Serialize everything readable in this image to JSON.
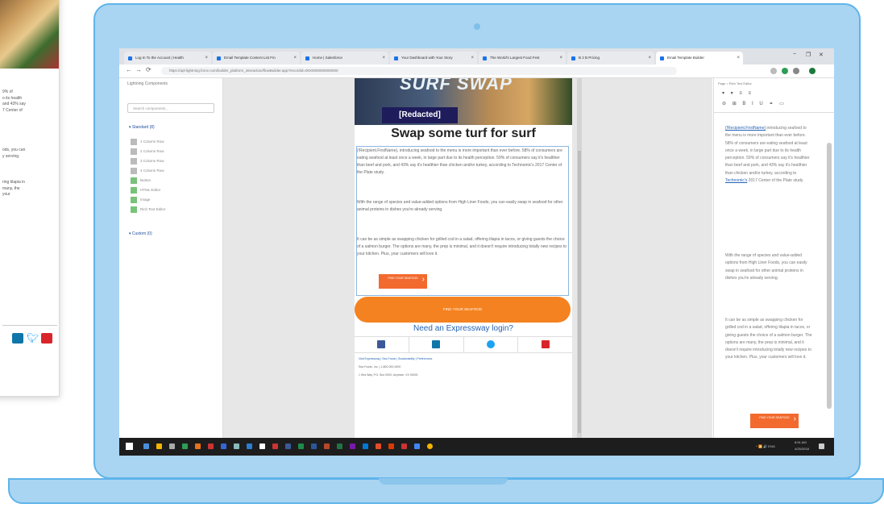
{
  "side_card": {
    "text_lines_1": [
      "9% of",
      "o its health",
      "and 43% say",
      "7 Center of"
    ],
    "text_lines_2": [
      "ods, you can",
      "y serving."
    ],
    "text_lines_3": [
      "ring tilapia in",
      "many, the",
      "your"
    ],
    "social_icons": [
      "linkedin-icon",
      "twitter-icon",
      "youtube-icon"
    ]
  },
  "browser": {
    "tabs": [
      {
        "label": "Log In To the Account | Health",
        "active": false
      },
      {
        "label": "Email Template Content List Fm",
        "active": false
      },
      {
        "label": "Home | Salesforce",
        "active": false
      },
      {
        "label": "Your Dashboard with Your Story",
        "active": false
      },
      {
        "label": "The World's Largest Food Fest",
        "active": false
      },
      {
        "label": "B 2 B Pricing",
        "active": false
      },
      {
        "label": "Email Template Builder",
        "active": true
      }
    ],
    "url": "https://apl-lightning.force.com/builder_platform_interaction/flowBuilder.app?recordId=00X0000000000000",
    "window_controls": [
      "−",
      "❐",
      "✕"
    ]
  },
  "left_panel": {
    "title": "Lightning Components",
    "search_placeholder": "Search components...",
    "standard_section": "Standard (8)",
    "standard_items": [
      {
        "label": "1 Column Row",
        "checked": false
      },
      {
        "label": "2 Column Row",
        "checked": false
      },
      {
        "label": "3 Column Row",
        "checked": false
      },
      {
        "label": "4 Column Row",
        "checked": false
      },
      {
        "label": "Button",
        "checked": true
      },
      {
        "label": "HTML Editor",
        "checked": true
      },
      {
        "label": "Image",
        "checked": true
      },
      {
        "label": "Rich Text Editor",
        "checked": true
      }
    ],
    "custom_section": "Custom (0)"
  },
  "email": {
    "hero_word": "SURF SWAP",
    "redacted_label": "[Redacted]",
    "headline": "Swap some turf for surf",
    "paragraph_1": "{!Recipient.FirstName}, introducing seafood to the menu is more important than ever before. 58% of consumers are eating seafood at least once a week, in large part due to its health perception. 59% of consumers say it's healthier than beef and pork, and 43% say it's healthier than chicken and/or turkey, according to Technomic's 2017 Center of the Plate study.",
    "paragraph_2": "With the range of species and value-added options from High Liner Foods, you can easily swap in seafood for other animal proteins in dishes you're already serving.",
    "paragraph_3": "It can be as simple as swapping chicken for grilled cod in a salad, offering tilapia in tacos, or giving guests the choice of a salmon burger. The options are many, the prep is minimal, and it doesn't require introducing totally new recipes to your kitchen. Plus, your customers will love it.",
    "small_button": "FIND YOUR SEAFOOD",
    "big_button": "FIND YOUR SEAFOOD",
    "login_link": "Need an Expressway login?",
    "footer_links": "Visit Expressway | Sea Foods | Sustainability | Preferences",
    "footer_line_1": "Sea Foods, Inc. | 1-800-000-0000",
    "footer_line_2": "1 Sea Way, P.O. Box 0000, Anytown, XX 00000"
  },
  "right_panel": {
    "breadcrumb": "Page > Rich Text Editor",
    "tools_row_1": "▾ ▾ ≡ ≡",
    "tools_row_2": "⊘ ⊞ B I U ⚭ ▭",
    "link_1": "{!Recipient.FirstName}",
    "text_a": "introducing seafood to the menu is more important than ever before. 58% of consumers are eating seafood at least once a week, in large part due to its health perception. 59% of consumers say it's healthier than beef and pork, and 43% say it's healthier than chicken and/or turkey, according to",
    "link_2": "Technomic's",
    "text_b": "2017 Center of the Plate study.",
    "text_c": "With the range of species and value-added options from High Liner Foods, you can easily swap in seafood for other animal proteins in dishes you're already serving.",
    "text_d": "It can be as simple as swapping chicken for grilled cod in a salad, offering tilapia in tacos, or giving guests the choice of a salmon burger. The options are many, the prep is minimal, and it doesn't require introducing totally new recipes to your kitchen. Plus, your customers will love it.",
    "button": "FIND YOUR SEAFOOD"
  },
  "taskbar": {
    "tray": "^ 📶 🔊 ENG",
    "time": "8:51 AM",
    "date": "4/25/2018"
  },
  "colors": {
    "laptop_fill": "#a9d5f2",
    "laptop_border": "#5fb4ea",
    "accent_orange": "#f58220",
    "link_blue": "#2563b4"
  }
}
